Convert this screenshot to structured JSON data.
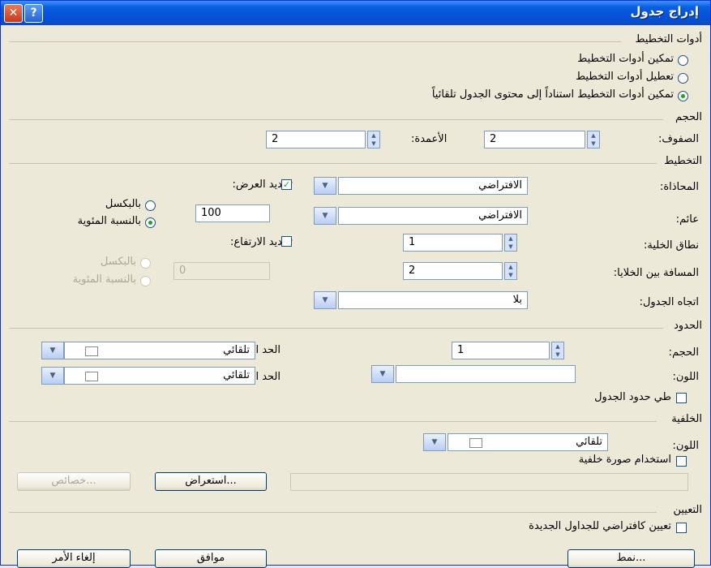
{
  "window": {
    "title": "إدراج جدول",
    "help": "?",
    "close": "✕"
  },
  "layout_tools": {
    "heading": "أدوات التخطيط",
    "options": [
      "تمكين أدوات التخطيط",
      "تعطيل أدوات التخطيط",
      "تمكين أدوات التخطيط استناداً إلى محتوى الجدول تلقائياً"
    ],
    "selected": 2
  },
  "size": {
    "heading": "الحجم",
    "rows_label": "الصفوف:",
    "rows": "2",
    "cols_label": "الأعمدة:",
    "cols": "2"
  },
  "layout": {
    "heading": "التخطيط",
    "align_label": "المحاذاة:",
    "align": "الافتراضي",
    "float_label": "عائم:",
    "float": "الافتراضي",
    "padding_label": "نطاق الخلية:",
    "padding": "1",
    "spacing_label": "المسافة بين الخلايا:",
    "spacing": "2",
    "direction_label": "اتجاه الجدول:",
    "direction": "بلا",
    "width_check": "تحديد العرض:",
    "width_checked": true,
    "width": "100",
    "width_px": "بالبكسل",
    "width_pct": "بالنسبة المئوية",
    "width_unit": "pct",
    "height_check": "تحديد الارتفاع:",
    "height_checked": false,
    "height": "0",
    "height_px": "بالبكسل",
    "height_pct": "بالنسبة المئوية"
  },
  "borders": {
    "heading": "الحدود",
    "size_label": "الحجم:",
    "size": "1",
    "color_label": "اللون:",
    "color": "",
    "light_label": "الحد الفاتح:",
    "light": "تلقائي",
    "dark_label": "الحد الداكن:",
    "dark": "تلقائي",
    "collapse": "طي حدود الجدول",
    "collapse_checked": false
  },
  "background": {
    "heading": "الخلفية",
    "color_label": "اللون:",
    "color": "تلقائي",
    "use_image": "استخدام صورة خلفية",
    "use_image_checked": false,
    "image_path": "",
    "browse": "استعراض...",
    "properties": "خصائص..."
  },
  "set_default": {
    "heading": "التعيين",
    "option": "تعيين كافتراضي للجداول الجديدة",
    "checked": false
  },
  "buttons": {
    "style": "نمط...",
    "ok": "موافق",
    "cancel": "إلغاء الأمر"
  }
}
